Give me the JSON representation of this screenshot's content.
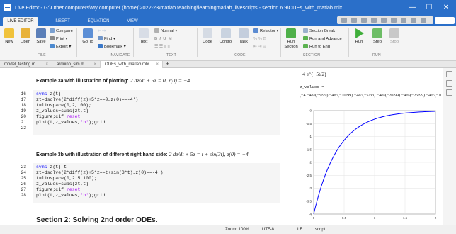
{
  "window": {
    "title": "Live Editor - G:\\Other computers\\My computer (home)\\2022-23\\matlab teaching\\learningmatlab_livescripts - section 6.9\\ODEs_with_matlab.mlx",
    "minimize": "—",
    "maximize": "☐",
    "close": "✕"
  },
  "ribbon_tabs": [
    "LIVE EDITOR",
    "INSERT",
    "EQUATION",
    "VIEW"
  ],
  "ribbon": {
    "file": {
      "new": "New",
      "open": "Open",
      "save": "Save",
      "compare": "Compare",
      "print": "Print",
      "export": "Export",
      "label": "FILE"
    },
    "navigate": {
      "goto": "Go To",
      "find": "Find",
      "bookmark": "Bookmark",
      "label": "NAVIGATE"
    },
    "text": {
      "text": "Text",
      "style": "Normal",
      "bold": "B",
      "italic": "I",
      "underline": "U",
      "mono": "M",
      "label": "TEXT"
    },
    "code": {
      "code": "Code",
      "control": "Control",
      "task": "Task",
      "refactor": "Refactor",
      "label": "CODE"
    },
    "section": {
      "run_section": "Run Section",
      "section_break": "Section Break",
      "run_and_advance": "Run and Advance",
      "run_to_end": "Run to End",
      "label": "SECTION"
    },
    "run": {
      "run": "Run",
      "step": "Step",
      "stop": "Stop",
      "label": "RUN"
    }
  },
  "doc_tabs": [
    {
      "label": "model_testing.m",
      "active": false
    },
    {
      "label": "arduino_sim.m",
      "active": false
    },
    {
      "label": "ODEs_with_matlab.mlx",
      "active": true
    }
  ],
  "editor": {
    "ex3a_heading": "Example 3a with illustration of plotting:",
    "ex3a_eq": "2 dz/dt + 5z = 0, z(0) = −4",
    "block1": {
      "line_numbers": [
        "16",
        "17",
        "18",
        "19",
        "20",
        "21",
        "22"
      ],
      "lines": [
        "syms z(t)",
        "zt=dsolve(2*diff(z)+5*z==0,z(0)==-4')",
        "t=linspace(0,2,100);",
        "z_values=subs(zt,t)",
        "figure;clf reset",
        "plot(t,z_values,'b');grid",
        ""
      ]
    },
    "ex3b_heading": "Example 3b with illustration of different right hand side:",
    "ex3b_eq": "2 dz/dt + 5z = t + sin(3t), z(0) = −4",
    "block2": {
      "line_numbers": [
        "23",
        "24",
        "25",
        "26",
        "27",
        "28"
      ],
      "lines": [
        "syms z(t) t",
        "zt=dsolve(2*diff(z)+5*z==t+sin(3*t),z(0)==-4')",
        "t=linspace(0,2.5,100);",
        "z_values=subs(zt,t)",
        "figure;clf reset",
        "plot(t,z_values,'b');grid"
      ]
    },
    "section2": "Section 2: Solving 2nd order ODEs."
  },
  "output": {
    "expr_top": "−4 e^(−5t/2)",
    "zvalues_label": "z_values =",
    "zvalues_row": "(−4  −4e^(−5/99)  −4e^(−10/99)  −4e^(−5/33)  −4e^(−20/99)  −4e^(−25/99)  −4e^(−10/33)"
  },
  "chart_data": {
    "type": "line",
    "series": [
      {
        "function": "z(t) = -4*exp(-5t/2)",
        "x_range": [
          0,
          2
        ],
        "points": 100,
        "color": "#0000ff"
      }
    ],
    "xlim": [
      0,
      2
    ],
    "ylim": [
      -4,
      0
    ],
    "xticks": [
      "0",
      "0.5",
      "1",
      "1.5",
      "2"
    ],
    "yticks": [
      "0",
      "-0.5",
      "-1",
      "-1.5",
      "-2",
      "-2.5",
      "-3",
      "-3.5",
      "-4"
    ],
    "grid": true
  },
  "status": {
    "zoom": "Zoom: 100%",
    "encoding": "UTF-8",
    "eol": "LF",
    "mode": "script"
  }
}
